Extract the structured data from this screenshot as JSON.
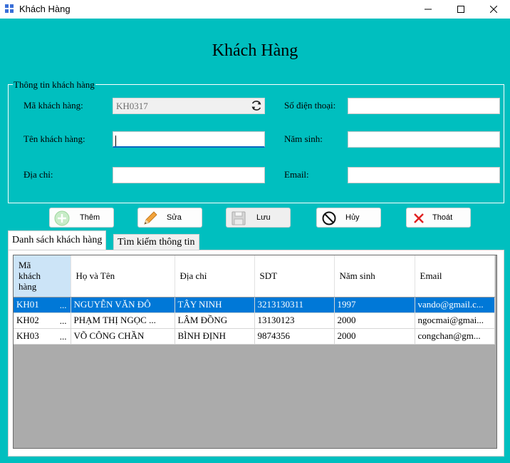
{
  "window": {
    "title": "Khách Hàng",
    "minimize_glyph": "—",
    "maximize_glyph": "☐",
    "close_glyph": "✕"
  },
  "form": {
    "title": "Khách Hàng",
    "group_label": "Thông tin khách hàng",
    "fields": {
      "ma_kh_label": "Mã khách hàng:",
      "ma_kh_value": "KH0317",
      "ten_kh_label": "Tên khách hàng:",
      "ten_kh_value": "",
      "dia_chi_label": "Địa chỉ:",
      "dia_chi_value": "",
      "sdt_label": "Số điện thoại:",
      "sdt_value": "",
      "nam_sinh_label": "Năm sinh:",
      "nam_sinh_value": "",
      "email_label": "Email:",
      "email_value": ""
    }
  },
  "buttons": {
    "them": "Thêm",
    "sua": "Sửa",
    "luu": "Lưu",
    "huy": "Hủy",
    "thoat": "Thoát"
  },
  "tabs": {
    "danh_sach": "Danh sách khách hàng",
    "tim_kiem": "Tìm kiếm thông tin"
  },
  "grid": {
    "headers": [
      "Mã khách hàng",
      "Họ và Tên",
      "Địa chỉ",
      "SDT",
      "Năm sinh",
      "Email"
    ],
    "rows": [
      {
        "id": "KH01",
        "dots": "...",
        "name": "NGUYỄN VĂN ĐÔ",
        "address": "TÂY NINH",
        "phone": "3213130311",
        "year": "1997",
        "email": "vando@gmail.c..."
      },
      {
        "id": "KH02",
        "dots": "...",
        "name": "PHẠM THỊ NGỌC ...",
        "address": "LÂM ĐỒNG",
        "phone": "13130123",
        "year": "2000",
        "email": "ngocmai@gmai..."
      },
      {
        "id": "KH03",
        "dots": "...",
        "name": "VÕ CÔNG CHẦN",
        "address": "BÌNH ĐỊNH",
        "phone": "9874356",
        "year": "2000",
        "email": "congchan@gm..."
      }
    ]
  },
  "colors": {
    "background": "#00bfbf",
    "selection": "#0078d7",
    "grid_empty": "#ababab"
  }
}
